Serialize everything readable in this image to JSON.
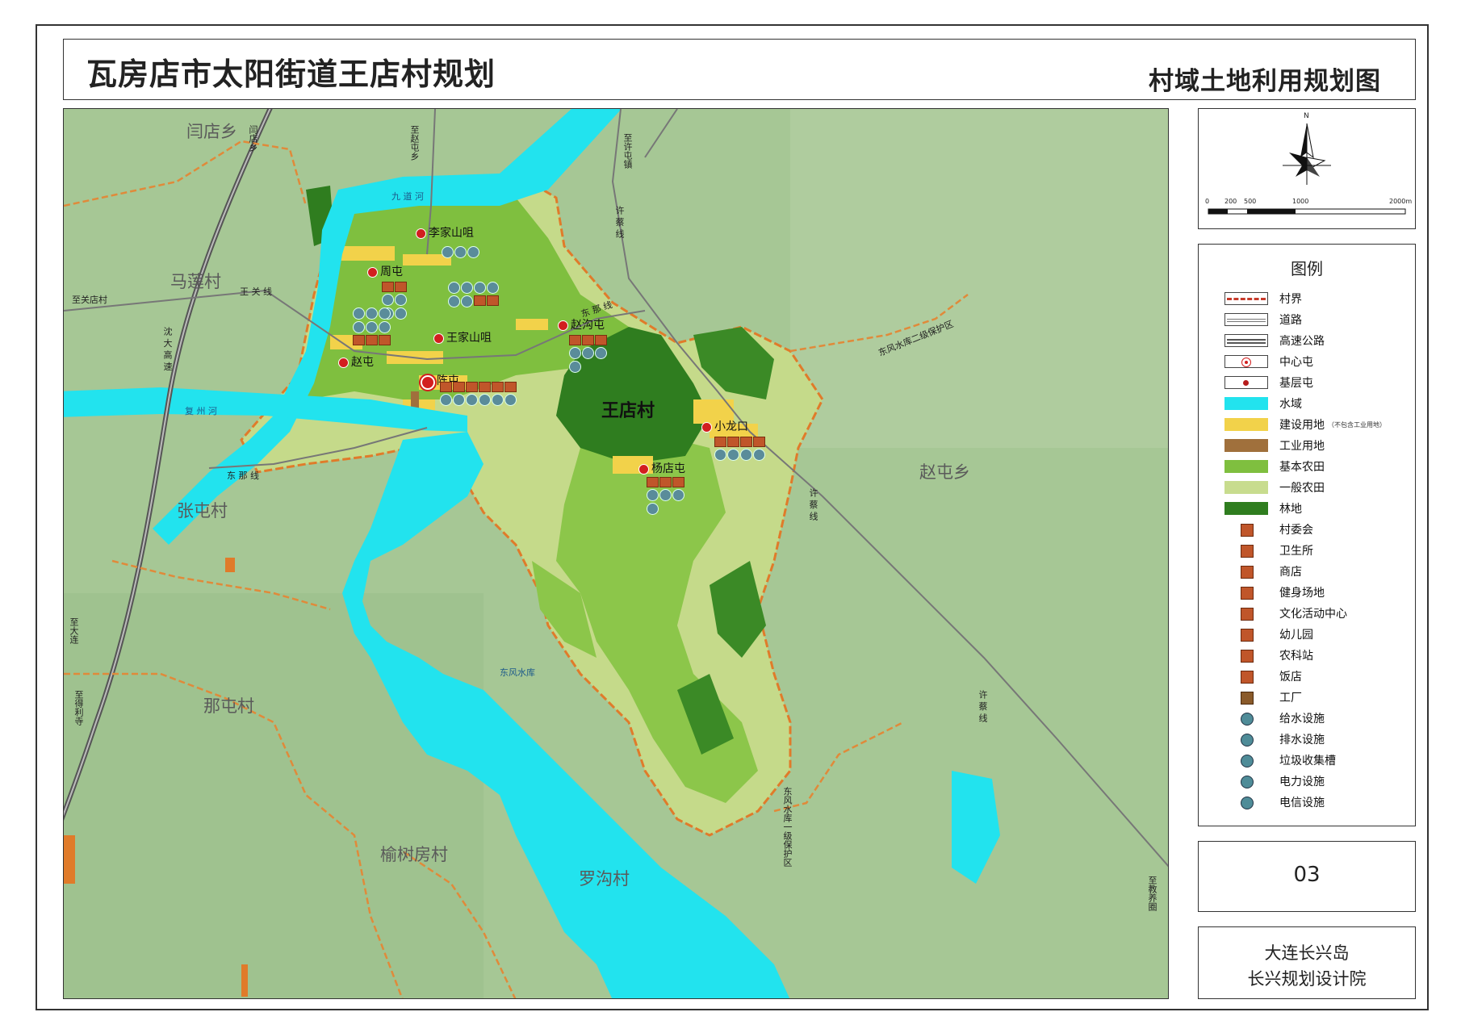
{
  "header": {
    "title": "瓦房店市太阳街道王店村规划",
    "subtitle": "村域土地利用规划图"
  },
  "map": {
    "village_name": "王店村",
    "surrounding_villages": {
      "yandian": "闫店乡",
      "malian": "马莲村",
      "zhangtun": "张屯村",
      "natun": "那屯村",
      "yushufang": "榆树房村",
      "luogou": "罗沟村",
      "zhaotun": "赵屯乡"
    },
    "settlements": {
      "lijia": "李家山咀",
      "zhoutun": "周屯",
      "wangjia": "王家山咀",
      "zhaotun_s": "赵屯",
      "chentun": "陈屯",
      "zhaogou": "赵沟屯",
      "xiaolongkou": "小龙口",
      "yangdian": "杨店屯"
    },
    "roads": {
      "to_guanjia": "至关店村",
      "wangguan": "王 关 线",
      "dongna_w": "东 那 线",
      "dongna_e": "东 那 线",
      "xucai_n": "许 蔡 线",
      "xucai_e": "许 蔡 线",
      "xucai_se": "许 蔡 线",
      "shenda": "沈 大 高 速",
      "to_zhaotun": "至赵屯乡",
      "to_xutun": "至许屯镇",
      "to_dalian": "至大连",
      "to_yandian": "闫店乡",
      "to_shichang": "至得利寺",
      "to_jiaoyuan": "至教养圈"
    },
    "water": {
      "jiudao": "九 道 河",
      "fuzhou": "复 州 河",
      "reservoir": "东风水库",
      "protect2": "东风水库二级保护区",
      "protect1": "东风水库一级保护区"
    }
  },
  "compass": {
    "north": "N",
    "scale_ticks": [
      "0",
      "200",
      "500",
      "1000",
      "2000m"
    ]
  },
  "legend": {
    "title": "图例",
    "items": [
      {
        "label": "村界"
      },
      {
        "label": "道路"
      },
      {
        "label": "高速公路"
      },
      {
        "label": "中心屯"
      },
      {
        "label": "基层屯"
      },
      {
        "label": "水域"
      },
      {
        "label": "建设用地",
        "note": "（不包含工业用地）"
      },
      {
        "label": "工业用地"
      },
      {
        "label": "基本农田"
      },
      {
        "label": "一般农田"
      },
      {
        "label": "林地"
      },
      {
        "label": "村委会"
      },
      {
        "label": "卫生所"
      },
      {
        "label": "商店"
      },
      {
        "label": "健身场地"
      },
      {
        "label": "文化活动中心"
      },
      {
        "label": "幼儿园"
      },
      {
        "label": "农科站"
      },
      {
        "label": "饭店"
      },
      {
        "label": "工厂"
      },
      {
        "label": "给水设施"
      },
      {
        "label": "排水设施"
      },
      {
        "label": "垃圾收集槽"
      },
      {
        "label": "电力设施"
      },
      {
        "label": "电信设施"
      }
    ]
  },
  "sheet_number": "03",
  "organization": {
    "line1": "大连长兴岛",
    "line2": "长兴规划设计院"
  },
  "colors": {
    "water": "#22e3ee",
    "construction": "#f2d24a",
    "industrial": "#a0703c",
    "basic_farmland": "#7fbf3f",
    "general_farmland": "#c8dc8e",
    "forest": "#2f7d1f",
    "boundary": "#e07b2a",
    "center": "#d21f1f"
  }
}
